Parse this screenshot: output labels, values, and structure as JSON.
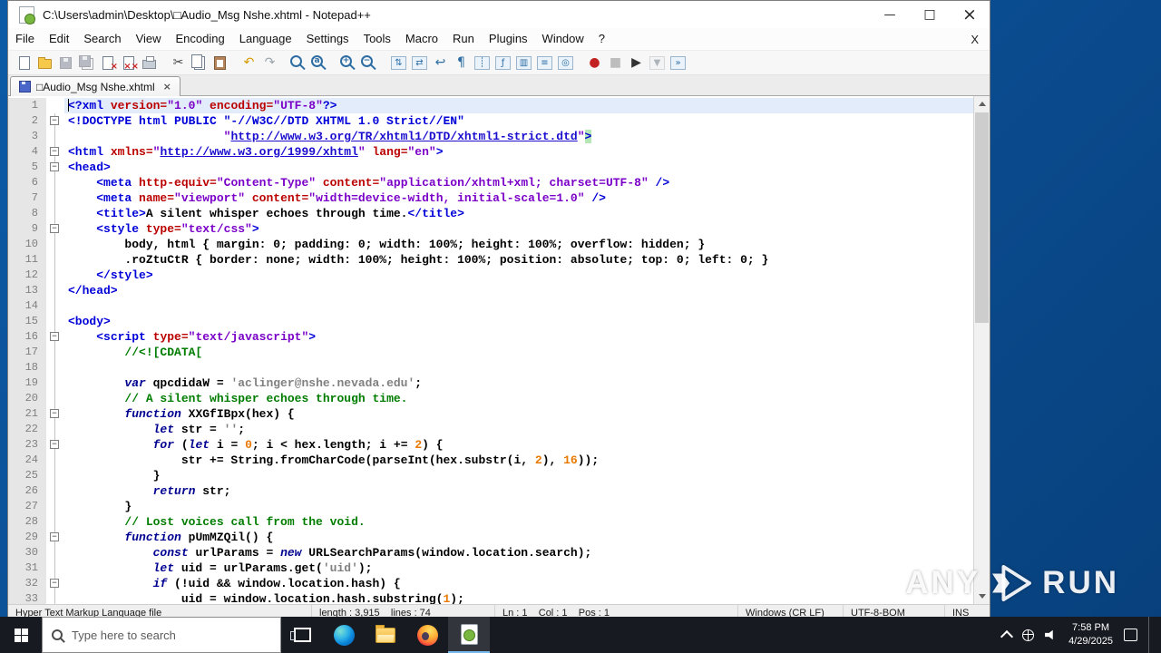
{
  "window": {
    "title": "C:\\Users\\admin\\Desktop\\□Audio_Msg Nshe.xhtml - Notepad++",
    "controls": {
      "minimize": "—",
      "maximize": "□",
      "close": "×"
    }
  },
  "menu": {
    "items": [
      "File",
      "Edit",
      "Search",
      "View",
      "Encoding",
      "Language",
      "Settings",
      "Tools",
      "Macro",
      "Run",
      "Plugins",
      "Window",
      "?"
    ],
    "close_label": "X"
  },
  "toolbar": {
    "icons": [
      {
        "name": "new-file-icon",
        "k": "doc"
      },
      {
        "name": "open-icon",
        "k": "folder"
      },
      {
        "name": "save-icon",
        "k": "floppy",
        "dis": true
      },
      {
        "name": "save-all-icon",
        "k": "floppy2",
        "dis": true
      },
      {
        "name": "close-icon",
        "k": "closedoc"
      },
      {
        "name": "close-all-icon",
        "k": "closeall"
      },
      {
        "name": "print-icon",
        "k": "print"
      },
      {
        "sep": true
      },
      {
        "name": "cut-icon",
        "k": "glyph",
        "g": "✂",
        "c": "#444"
      },
      {
        "name": "copy-icon",
        "k": "copy"
      },
      {
        "name": "paste-icon",
        "k": "paste"
      },
      {
        "sep": true
      },
      {
        "name": "undo-icon",
        "k": "glyph",
        "g": "↶",
        "c": "#d79b00"
      },
      {
        "name": "redo-icon",
        "k": "glyph",
        "g": "↷",
        "c": "#9aa4ad"
      },
      {
        "sep": true
      },
      {
        "name": "find-icon",
        "k": "mag"
      },
      {
        "name": "replace-icon",
        "k": "magab"
      },
      {
        "sep": true
      },
      {
        "name": "zoom-in-icon",
        "k": "magp"
      },
      {
        "name": "zoom-out-icon",
        "k": "magm"
      },
      {
        "sep": true
      },
      {
        "name": "sync-vertical-scroll-icon",
        "k": "frame",
        "g": "⇅"
      },
      {
        "name": "sync-horizontal-scroll-icon",
        "k": "frame",
        "g": "⇄"
      },
      {
        "name": "word-wrap-icon",
        "k": "glyph",
        "g": "↩",
        "c": "#2d6da3"
      },
      {
        "name": "show-all-characters-icon",
        "k": "glyph",
        "g": "¶",
        "c": "#2d6da3"
      },
      {
        "name": "show-indent-guide-icon",
        "k": "frame",
        "g": "┊"
      },
      {
        "name": "function-list-icon",
        "k": "frame",
        "g": "ƒ"
      },
      {
        "name": "document-map-icon",
        "k": "frame",
        "g": "▥"
      },
      {
        "name": "document-list-icon",
        "k": "frame",
        "g": "≡"
      },
      {
        "name": "monitoring-icon",
        "k": "frame",
        "g": "◎"
      },
      {
        "sep": true
      },
      {
        "name": "macro-record-icon",
        "k": "glyph",
        "g": "●",
        "c": "#c22222"
      },
      {
        "name": "macro-stop-icon",
        "k": "glyph",
        "g": "■",
        "c": "#777",
        "dis": true
      },
      {
        "name": "macro-play-icon",
        "k": "glyph",
        "g": "▶",
        "c": "#333"
      },
      {
        "name": "macro-save-icon",
        "k": "frame",
        "g": "▼",
        "dis": true
      },
      {
        "name": "macro-run-multi-icon",
        "k": "frame",
        "g": "»"
      }
    ]
  },
  "tabs": [
    {
      "label": "□Audio_Msg Nshe.xhtml",
      "close_glyph": "×"
    }
  ],
  "editor": {
    "current_line": 1,
    "lines": [
      {
        "n": 1,
        "segs": [
          [
            "t",
            "<?xml "
          ],
          [
            "a",
            "version="
          ],
          [
            "v",
            "\"1.0\""
          ],
          [
            "a",
            " encoding="
          ],
          [
            "v",
            "\"UTF-8\""
          ],
          [
            "t",
            "?>"
          ]
        ]
      },
      {
        "n": 2,
        "f": 1,
        "segs": [
          [
            "t",
            "<!DOCTYPE html PUBLIC \"-//W3C//DTD XHTML 1.0 Strict//EN\""
          ]
        ]
      },
      {
        "n": 3,
        "segs": [
          [
            "p",
            "                      "
          ],
          [
            "v",
            "\""
          ],
          [
            "l",
            "http://www.w3.org/TR/xhtml1/DTD/xhtml1-strict.dtd"
          ],
          [
            "v",
            "\""
          ],
          [
            "m",
            ">"
          ]
        ]
      },
      {
        "n": 4,
        "f": 1,
        "segs": [
          [
            "t",
            "<html "
          ],
          [
            "a",
            "xmlns="
          ],
          [
            "v",
            "\""
          ],
          [
            "l",
            "http://www.w3.org/1999/xhtml"
          ],
          [
            "v",
            "\""
          ],
          [
            "a",
            " lang="
          ],
          [
            "v",
            "\"en\""
          ],
          [
            "t",
            ">"
          ]
        ]
      },
      {
        "n": 5,
        "f": 1,
        "segs": [
          [
            "t",
            "<head>"
          ]
        ]
      },
      {
        "n": 6,
        "segs": [
          [
            "p",
            "    "
          ],
          [
            "t",
            "<meta "
          ],
          [
            "a",
            "http-equiv="
          ],
          [
            "v",
            "\"Content-Type\""
          ],
          [
            "a",
            " content="
          ],
          [
            "v",
            "\"application/xhtml+xml; charset=UTF-8\""
          ],
          [
            "t",
            " />"
          ]
        ]
      },
      {
        "n": 7,
        "segs": [
          [
            "p",
            "    "
          ],
          [
            "t",
            "<meta "
          ],
          [
            "a",
            "name="
          ],
          [
            "v",
            "\"viewport\""
          ],
          [
            "a",
            " content="
          ],
          [
            "v",
            "\"width=device-width, initial-scale=1.0\""
          ],
          [
            "t",
            " />"
          ]
        ]
      },
      {
        "n": 8,
        "segs": [
          [
            "p",
            "    "
          ],
          [
            "t",
            "<title>"
          ],
          [
            "p",
            "A silent whisper echoes through time."
          ],
          [
            "t",
            "</title>"
          ]
        ]
      },
      {
        "n": 9,
        "f": 1,
        "segs": [
          [
            "p",
            "    "
          ],
          [
            "t",
            "<style "
          ],
          [
            "a",
            "type="
          ],
          [
            "v",
            "\"text/css\""
          ],
          [
            "t",
            ">"
          ]
        ]
      },
      {
        "n": 10,
        "segs": [
          [
            "p",
            "        body, html { margin: 0; padding: 0; width: 100%; height: 100%; overflow: hidden; }"
          ]
        ]
      },
      {
        "n": 11,
        "segs": [
          [
            "p",
            "        .roZtuCtR { border: none; width: 100%; height: 100%; position: absolute; top: 0; left: 0; }"
          ]
        ]
      },
      {
        "n": 12,
        "segs": [
          [
            "p",
            "    "
          ],
          [
            "t",
            "</style>"
          ]
        ]
      },
      {
        "n": 13,
        "segs": [
          [
            "t",
            "</head>"
          ]
        ]
      },
      {
        "n": 14,
        "segs": []
      },
      {
        "n": 15,
        "segs": [
          [
            "t",
            "<body>"
          ]
        ]
      },
      {
        "n": 16,
        "f": 1,
        "segs": [
          [
            "p",
            "    "
          ],
          [
            "t",
            "<script "
          ],
          [
            "a",
            "type="
          ],
          [
            "v",
            "\"text/javascript\""
          ],
          [
            "t",
            ">"
          ]
        ]
      },
      {
        "n": 17,
        "segs": [
          [
            "p",
            "        "
          ],
          [
            "c",
            "//<![CDATA["
          ]
        ]
      },
      {
        "n": 18,
        "segs": []
      },
      {
        "n": 19,
        "segs": [
          [
            "p",
            "        "
          ],
          [
            "k",
            "var"
          ],
          [
            "p",
            " qpcdidaW = "
          ],
          [
            "s",
            "'aclinger@nshe.nevada.edu'"
          ],
          [
            "p",
            ";"
          ]
        ]
      },
      {
        "n": 20,
        "segs": [
          [
            "p",
            "        "
          ],
          [
            "c",
            "// A silent whisper echoes through time."
          ]
        ]
      },
      {
        "n": 21,
        "f": 1,
        "segs": [
          [
            "p",
            "        "
          ],
          [
            "k",
            "function"
          ],
          [
            "p",
            " XXGfIBpx(hex) {"
          ]
        ]
      },
      {
        "n": 22,
        "segs": [
          [
            "p",
            "            "
          ],
          [
            "k",
            "let"
          ],
          [
            "p",
            " str = "
          ],
          [
            "s",
            "''"
          ],
          [
            "p",
            ";"
          ]
        ]
      },
      {
        "n": 23,
        "f": 1,
        "segs": [
          [
            "p",
            "            "
          ],
          [
            "k",
            "for"
          ],
          [
            "p",
            " ("
          ],
          [
            "k",
            "let"
          ],
          [
            "p",
            " i = "
          ],
          [
            "n_",
            "0"
          ],
          [
            "p",
            "; i < hex.length; i += "
          ],
          [
            "n_",
            "2"
          ],
          [
            "p",
            ") {"
          ]
        ]
      },
      {
        "n": 24,
        "segs": [
          [
            "p",
            "                str += String.fromCharCode(parseInt(hex.substr(i, "
          ],
          [
            "n_",
            "2"
          ],
          [
            "p",
            "), "
          ],
          [
            "n_",
            "16"
          ],
          [
            "p",
            "));"
          ]
        ]
      },
      {
        "n": 25,
        "segs": [
          [
            "p",
            "            }"
          ]
        ]
      },
      {
        "n": 26,
        "segs": [
          [
            "p",
            "            "
          ],
          [
            "k",
            "return"
          ],
          [
            "p",
            " str;"
          ]
        ]
      },
      {
        "n": 27,
        "segs": [
          [
            "p",
            "        }"
          ]
        ]
      },
      {
        "n": 28,
        "segs": [
          [
            "p",
            "        "
          ],
          [
            "c",
            "// Lost voices call from the void."
          ]
        ]
      },
      {
        "n": 29,
        "f": 1,
        "segs": [
          [
            "p",
            "        "
          ],
          [
            "k",
            "function"
          ],
          [
            "p",
            " pUmMZQil() {"
          ]
        ]
      },
      {
        "n": 30,
        "segs": [
          [
            "p",
            "            "
          ],
          [
            "k",
            "const"
          ],
          [
            "p",
            " urlParams = "
          ],
          [
            "k",
            "new"
          ],
          [
            "p",
            " URLSearchParams(window.location.search);"
          ]
        ]
      },
      {
        "n": 31,
        "segs": [
          [
            "p",
            "            "
          ],
          [
            "k",
            "let"
          ],
          [
            "p",
            " uid = urlParams.get("
          ],
          [
            "s",
            "'uid'"
          ],
          [
            "p",
            ");"
          ]
        ]
      },
      {
        "n": 32,
        "f": 1,
        "segs": [
          [
            "p",
            "            "
          ],
          [
            "k",
            "if"
          ],
          [
            "p",
            " (!uid && window.location.hash) {"
          ]
        ]
      },
      {
        "n": 33,
        "segs": [
          [
            "p",
            "                uid = window.location.hash.substring("
          ],
          [
            "n_",
            "1"
          ],
          [
            "p",
            ");"
          ]
        ]
      }
    ]
  },
  "status": {
    "doc_type": "Hyper Text Markup Language file",
    "length_lines": "length : 3,915    lines : 74",
    "position": "Ln : 1    Col : 1    Pos : 1",
    "eol": "Windows (CR LF)",
    "encoding": "UTF-8-BOM",
    "insert_mode": "INS"
  },
  "taskbar": {
    "search_placeholder": "Type here to search",
    "time": "7:58 PM",
    "date": "4/29/2025"
  },
  "watermark": {
    "left": "ANY",
    "right": "RUN"
  },
  "colors": {
    "desktop": "#0b59a3",
    "taskbar": "#171a21",
    "current_line": "#e2ecfa",
    "tag": "#0000d8",
    "attribute": "#bb0000",
    "value": "#7a00c8",
    "string": "#808080",
    "comment": "#007d00",
    "keyword": "#000090",
    "number": "#e87800"
  }
}
